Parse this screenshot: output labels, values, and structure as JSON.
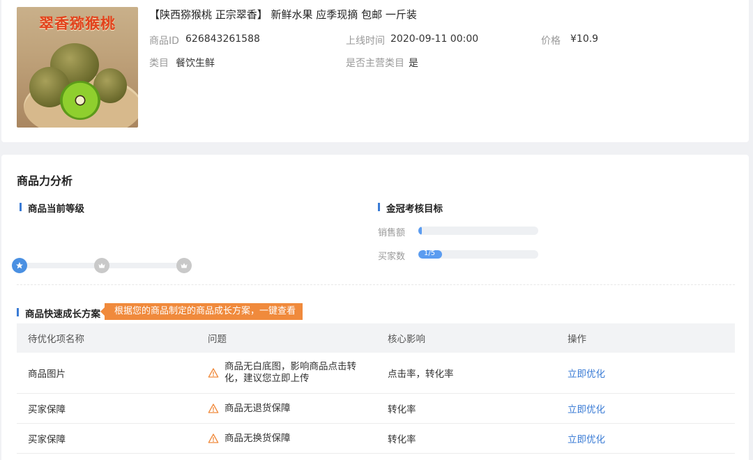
{
  "product": {
    "image_text": "翠香猕猴桃",
    "title": "【陕西猕猴桃 正宗翠香】 新鲜水果 应季现摘 包邮 一斤装",
    "fields": [
      {
        "label": "商品ID",
        "value": "626843261588"
      },
      {
        "label": "上线时间",
        "value": "2020-09-11 00:00"
      },
      {
        "label": "价格",
        "value": "¥10.9"
      },
      {
        "label": "类目",
        "value": "餐饮生鲜"
      },
      {
        "label": "是否主营类目",
        "value": "是"
      }
    ]
  },
  "analysis": {
    "title": "商品力分析",
    "current_level": {
      "title": "商品当前等级",
      "levels": [
        {
          "icon": "star-icon",
          "active": true
        },
        {
          "icon": "crown-icon",
          "active": false
        },
        {
          "icon": "crown-icon",
          "active": false
        }
      ]
    },
    "goal": {
      "title": "金冠考核目标",
      "rows": [
        {
          "label": "销售额",
          "progress": 0.03,
          "text": "",
          "color": "#5b9cf0"
        },
        {
          "label": "买家数",
          "progress": 0.2,
          "text": "1/5",
          "color": "#5b9cf0"
        }
      ]
    },
    "growth": {
      "title": "商品快速成长方案",
      "tip": "根据您的商品制定的商品成长方案，一键查看",
      "columns": [
        "待优化项名称",
        "问题",
        "核心影响",
        "操作"
      ],
      "rows": [
        {
          "name": "商品图片",
          "issue": "商品无白底图，影响商品点击转化，建议您立即上传",
          "impact": "点击率，转化率",
          "action": "立即优化"
        },
        {
          "name": "买家保障",
          "issue": "商品无退货保障",
          "impact": "转化率",
          "action": "立即优化"
        },
        {
          "name": "买家保障",
          "issue": "商品无换货保障",
          "impact": "转化率",
          "action": "立即优化"
        }
      ]
    }
  },
  "colors": {
    "accent": "#3a7bd5",
    "tip": "#f08a3c",
    "warning": "#f08a3c"
  }
}
